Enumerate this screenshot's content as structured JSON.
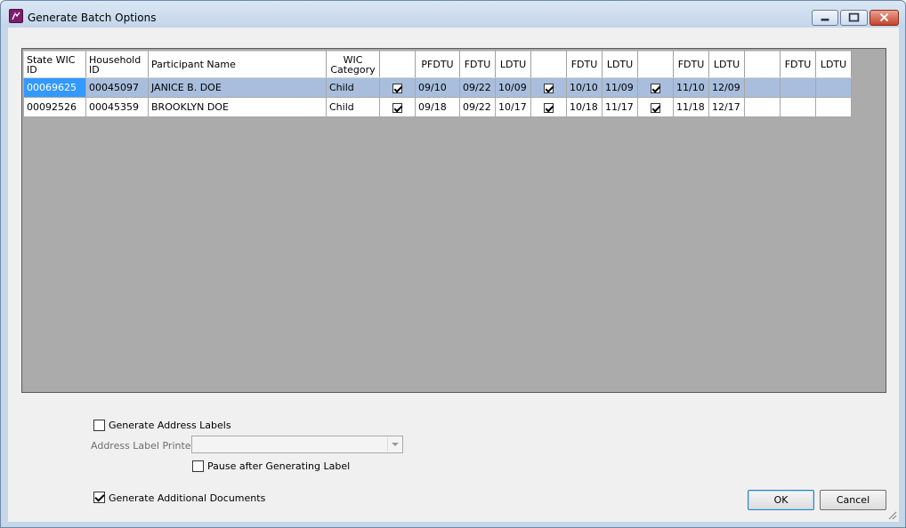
{
  "window": {
    "title": "Generate Batch Options"
  },
  "grid": {
    "columns": [
      {
        "label": "State WIC ID"
      },
      {
        "label": "Household ID"
      },
      {
        "label": "Participant Name"
      },
      {
        "label": "WIC Category"
      },
      {
        "label": ""
      },
      {
        "label": "PFDTU"
      },
      {
        "label": "FDTU"
      },
      {
        "label": "LDTU"
      },
      {
        "label": ""
      },
      {
        "label": "FDTU"
      },
      {
        "label": "LDTU"
      },
      {
        "label": ""
      },
      {
        "label": "FDTU"
      },
      {
        "label": "LDTU"
      },
      {
        "label": ""
      },
      {
        "label": "FDTU"
      },
      {
        "label": "LDTU"
      }
    ],
    "rows": [
      {
        "selected": true,
        "state_wic_id": "00069625",
        "household_id": "00045097",
        "participant_name": "JANICE B. DOE",
        "wic_category": "Child",
        "set1_checked": true,
        "pfdtu": "09/10",
        "fdtu1": "09/22",
        "ldtu1": "10/09",
        "set2_checked": true,
        "fdtu2": "10/10",
        "ldtu2": "11/09",
        "set3_checked": true,
        "fdtu3": "11/10",
        "ldtu3": "12/09",
        "set4_checked": false,
        "fdtu4": "",
        "ldtu4": ""
      },
      {
        "selected": false,
        "state_wic_id": "00092526",
        "household_id": "00045359",
        "participant_name": "BROOKLYN DOE",
        "wic_category": "Child",
        "set1_checked": true,
        "pfdtu": "09/18",
        "fdtu1": "09/22",
        "ldtu1": "10/17",
        "set2_checked": true,
        "fdtu2": "10/18",
        "ldtu2": "11/17",
        "set3_checked": true,
        "fdtu3": "11/18",
        "ldtu3": "12/17",
        "set4_checked": false,
        "fdtu4": "",
        "ldtu4": ""
      }
    ]
  },
  "options": {
    "generate_address_labels": {
      "label": "Generate Address Labels",
      "checked": false
    },
    "address_label_printer": {
      "label": "Address Label Printer",
      "value": "",
      "enabled": false
    },
    "pause_after_label": {
      "label": "Pause after Generating Label",
      "checked": false
    },
    "generate_additional_documents": {
      "label": "Generate Additional Documents",
      "checked": true
    }
  },
  "buttons": {
    "ok": "OK",
    "cancel": "Cancel"
  },
  "icons": {
    "app": "app-icon",
    "minimize": "minimize-icon",
    "restore": "restore-icon",
    "close": "close-icon",
    "resize_grip": "resize-grip-icon"
  }
}
